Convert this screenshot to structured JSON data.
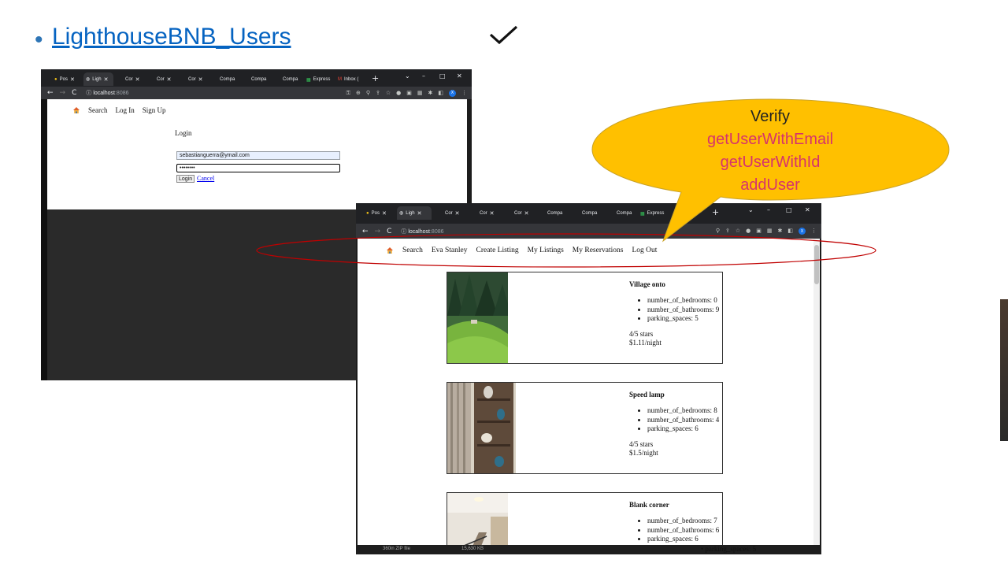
{
  "slide": {
    "bullet": "•",
    "title": "LighthouseBNB_Users",
    "check": "✓"
  },
  "window_login": {
    "tabs": [
      {
        "label": "Pos",
        "icon": "postgres-icon"
      },
      {
        "label": "Ligh",
        "icon": "globe-icon"
      },
      {
        "label": "Cor",
        "icon": ""
      },
      {
        "label": "Cor",
        "icon": ""
      },
      {
        "label": "Cor",
        "icon": ""
      },
      {
        "label": "Compa",
        "icon": ""
      },
      {
        "label": "Compa",
        "icon": ""
      },
      {
        "label": "Compa",
        "icon": ""
      },
      {
        "label": "Express",
        "icon": "express-icon"
      },
      {
        "label": "Inbox (",
        "icon": "gmail-icon"
      }
    ],
    "url_host": "localhost",
    "url_port": ":8086",
    "nav": {
      "search": "Search",
      "login": "Log In",
      "signup": "Sign Up"
    },
    "form": {
      "heading": "Login",
      "email_value": "sebastianguerra@ymail.com",
      "password_value": "••••••••",
      "login_button": "Login",
      "cancel_link": "Cancel"
    }
  },
  "window_listings": {
    "tabs": [
      {
        "label": "Pos",
        "icon": "postgres-icon"
      },
      {
        "label": "Ligh",
        "icon": "globe-icon"
      },
      {
        "label": "Cor",
        "icon": ""
      },
      {
        "label": "Cor",
        "icon": ""
      },
      {
        "label": "Cor",
        "icon": ""
      },
      {
        "label": "Compa",
        "icon": ""
      },
      {
        "label": "Compa",
        "icon": ""
      },
      {
        "label": "Compa",
        "icon": ""
      },
      {
        "label": "Express",
        "icon": "express-icon"
      }
    ],
    "url_host": "localhost",
    "url_port": ":8086",
    "nav": {
      "search": "Search",
      "user": "Eva Stanley",
      "create": "Create Listing",
      "my_listings": "My Listings",
      "my_reservations": "My Reservations",
      "logout": "Log Out"
    },
    "listings": [
      {
        "title": "Village onto",
        "bedrooms": "number_of_bedrooms: 0",
        "bathrooms": "number_of_bathrooms: 9",
        "parking": "parking_spaces: 5",
        "stars": "4/5 stars",
        "price": "$1.11/night"
      },
      {
        "title": "Speed lamp",
        "bedrooms": "number_of_bedrooms: 8",
        "bathrooms": "number_of_bathrooms: 4",
        "parking": "parking_spaces: 6",
        "stars": "4/5 stars",
        "price": "$1.5/night"
      },
      {
        "title": "Blank corner",
        "bedrooms": "number_of_bedrooms: 7",
        "bathrooms": "number_of_bathrooms: 6",
        "parking": "parking_spaces: 6"
      }
    ],
    "footer": {
      "file_name": "360in ZIP file",
      "file_size": "15,630 KB",
      "behind_text": "parking_spaces: 5"
    }
  },
  "callout": {
    "heading": "Verify",
    "functions": [
      "getUserWithEmail",
      "getUserWithId",
      "addUser"
    ],
    "fill_color": "#ffc000",
    "text_color": "#d6336c"
  },
  "colors": {
    "title_link": "#0563c1",
    "highlight_ellipse": "#c00000",
    "browser_chrome": "#202124"
  }
}
